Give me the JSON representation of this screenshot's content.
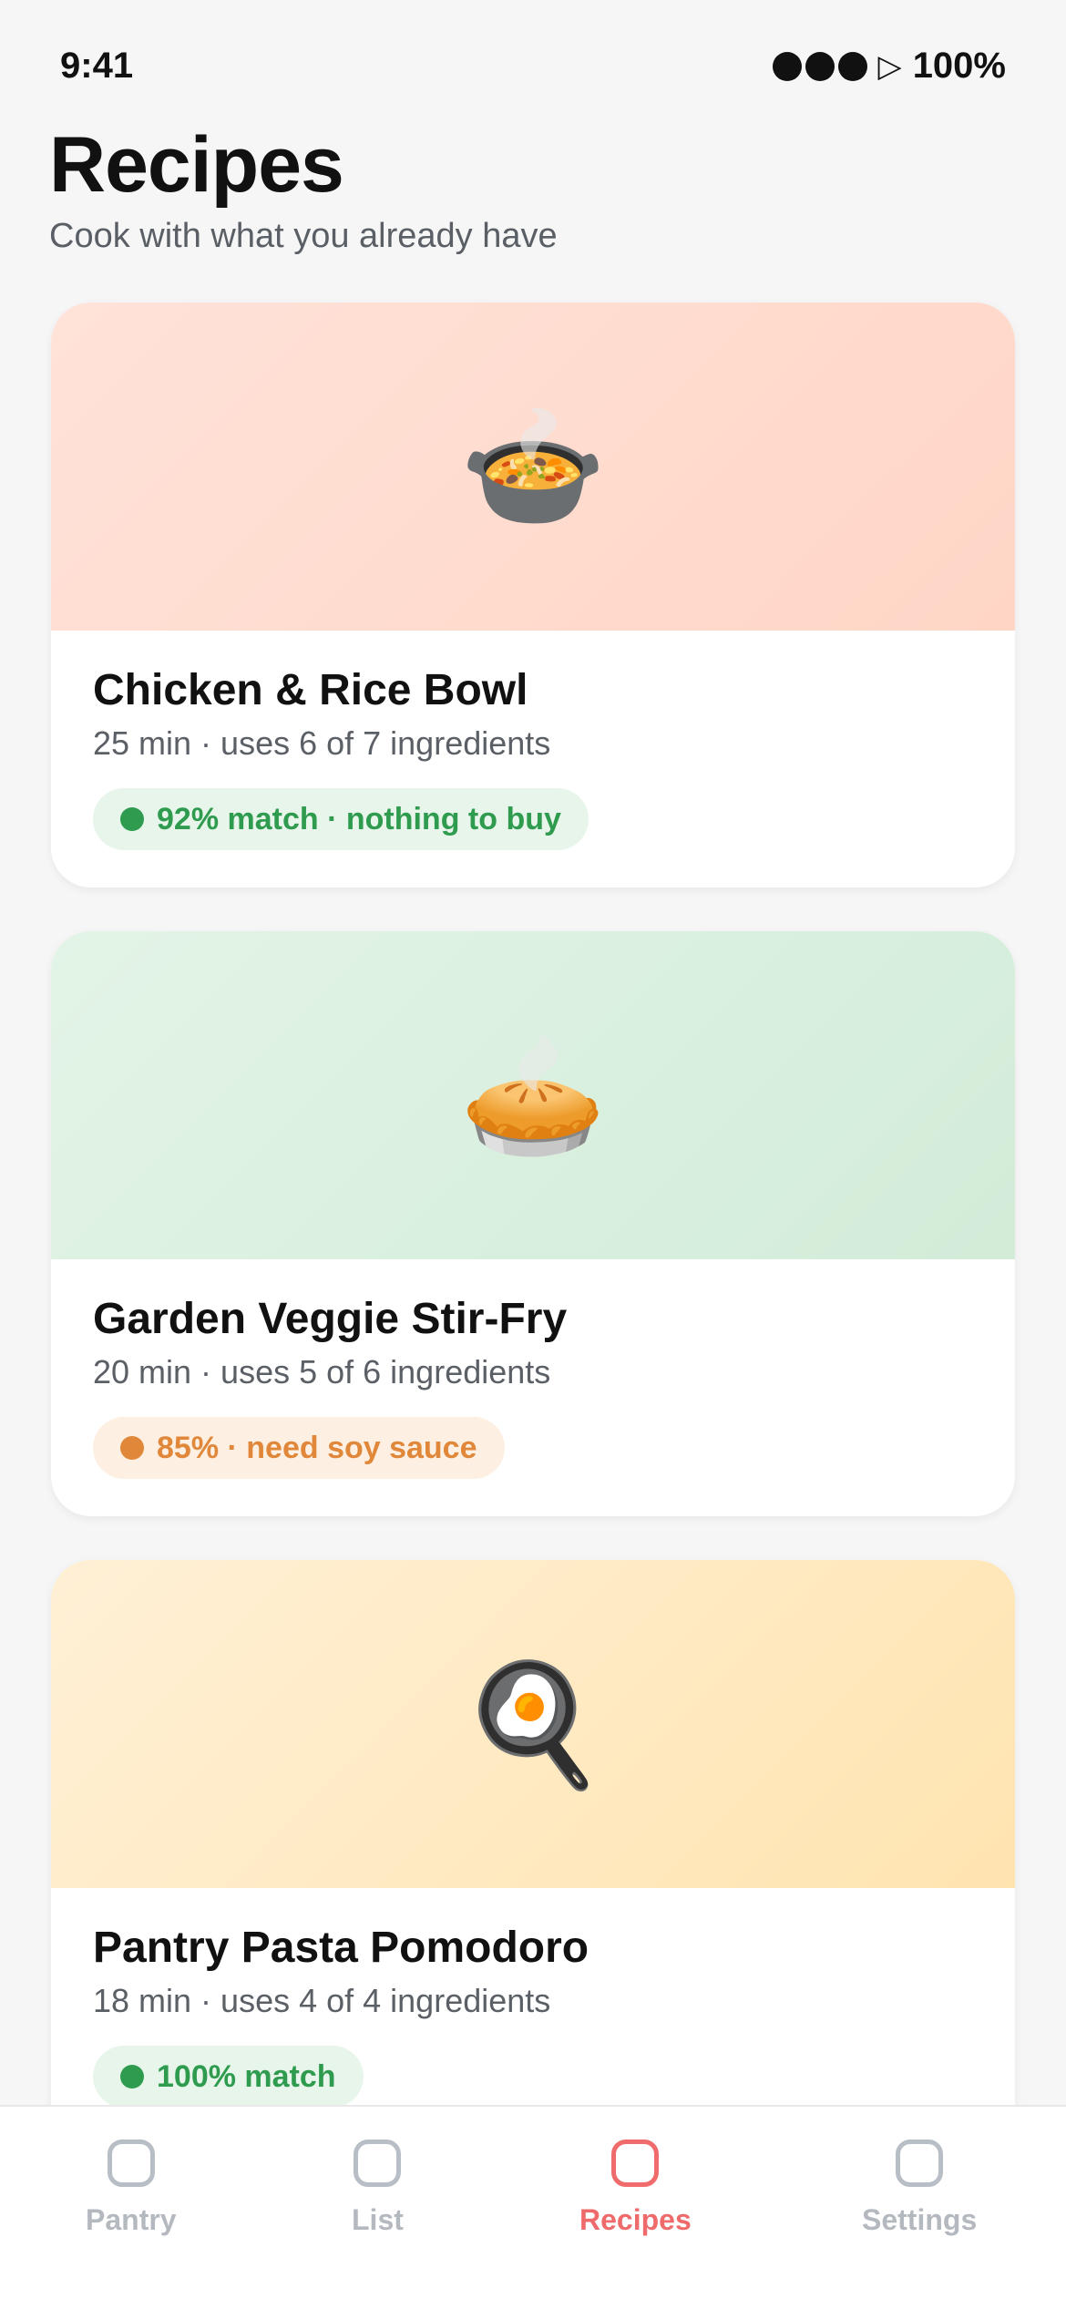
{
  "status": {
    "time": "9:41",
    "battery": "100%",
    "signal_icon": "signal-dots-icon",
    "location_icon": "play-arrow-icon"
  },
  "header": {
    "title": "Recipes",
    "subtitle": "Cook with what you already have"
  },
  "recipes": [
    {
      "name": "Chicken & Rice Bowl",
      "meta": "25 min · uses 6 of 7 ingredients",
      "badge": "92% match · nothing to buy",
      "badge_color": "#2e9b4e",
      "badge_bg": "#e7f5ea",
      "hero_emoji": "🍲",
      "hero_icon": "stew-bowl-icon",
      "hero_bg_from": "#ffe2d9",
      "hero_bg_to": "#ffd6c6"
    },
    {
      "name": "Garden Veggie Stir-Fry",
      "meta": "20 min · uses 5 of 6 ingredients",
      "badge": "85% · need soy sauce",
      "badge_color": "#e0873a",
      "badge_bg": "#fdf0e3",
      "hero_emoji": "🥧",
      "hero_icon": "pie-icon",
      "hero_bg_from": "#e3f4e7",
      "hero_bg_to": "#d2ecd8"
    },
    {
      "name": "Pantry Pasta Pomodoro",
      "meta": "18 min · uses 4 of 4 ingredients",
      "badge": "100% match",
      "badge_color": "#2e9b4e",
      "badge_bg": "#e7f5ea",
      "hero_emoji": "🍳",
      "hero_icon": "frying-pan-egg-icon",
      "hero_bg_from": "#fff0d6",
      "hero_bg_to": "#ffe4b0"
    }
  ],
  "tabs": [
    {
      "label": "Pantry",
      "active": false
    },
    {
      "label": "List",
      "active": false
    },
    {
      "label": "Recipes",
      "active": true
    },
    {
      "label": "Settings",
      "active": false
    }
  ],
  "colors": {
    "accent": "#ef6b6b",
    "background": "#f6f6f7"
  }
}
